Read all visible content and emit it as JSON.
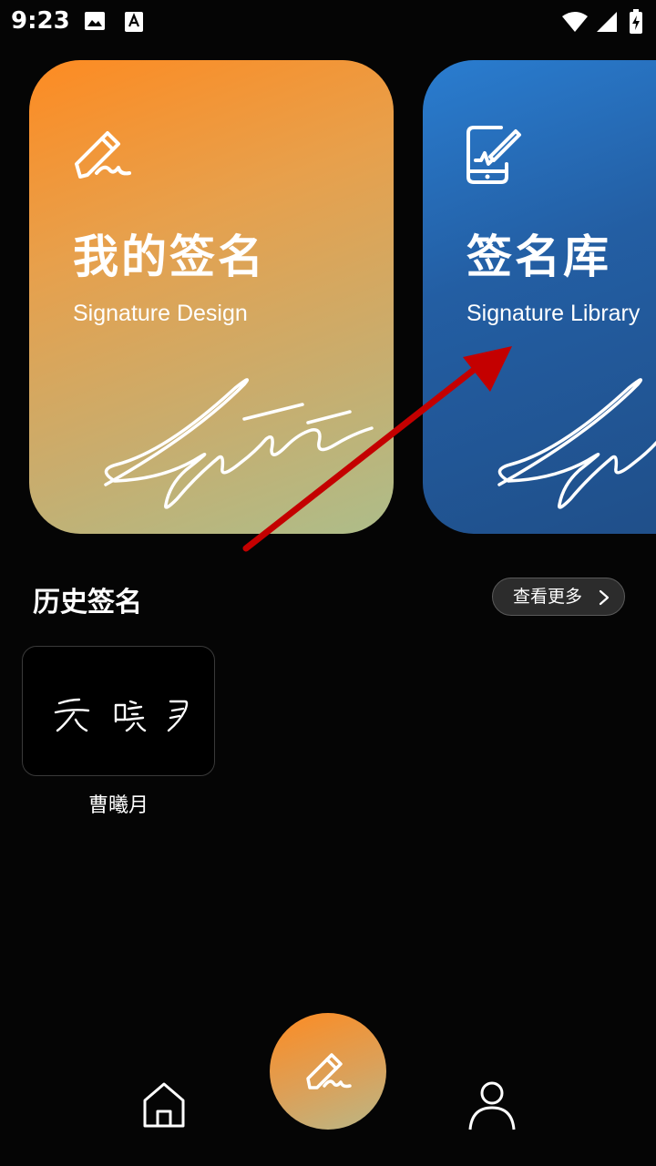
{
  "status_bar": {
    "time": "9:23"
  },
  "cards": [
    {
      "title": "我的签名",
      "subtitle": "Signature Design",
      "icon": "pen-signature-icon"
    },
    {
      "title": "签名库",
      "subtitle": "Signature Library",
      "icon": "tablet-signature-icon"
    }
  ],
  "history": {
    "title": "历史签名",
    "more_label": "查看更多",
    "items": [
      {
        "name": "曹曦月",
        "preview_text": "云曦月"
      }
    ]
  },
  "nav": {
    "items": [
      "home-icon",
      "pen-icon",
      "profile-icon"
    ]
  },
  "colors": {
    "accent_orange": "#fd8b22",
    "accent_blue": "#2a7dd0",
    "background": "#050505",
    "arrow": "#c40000"
  }
}
